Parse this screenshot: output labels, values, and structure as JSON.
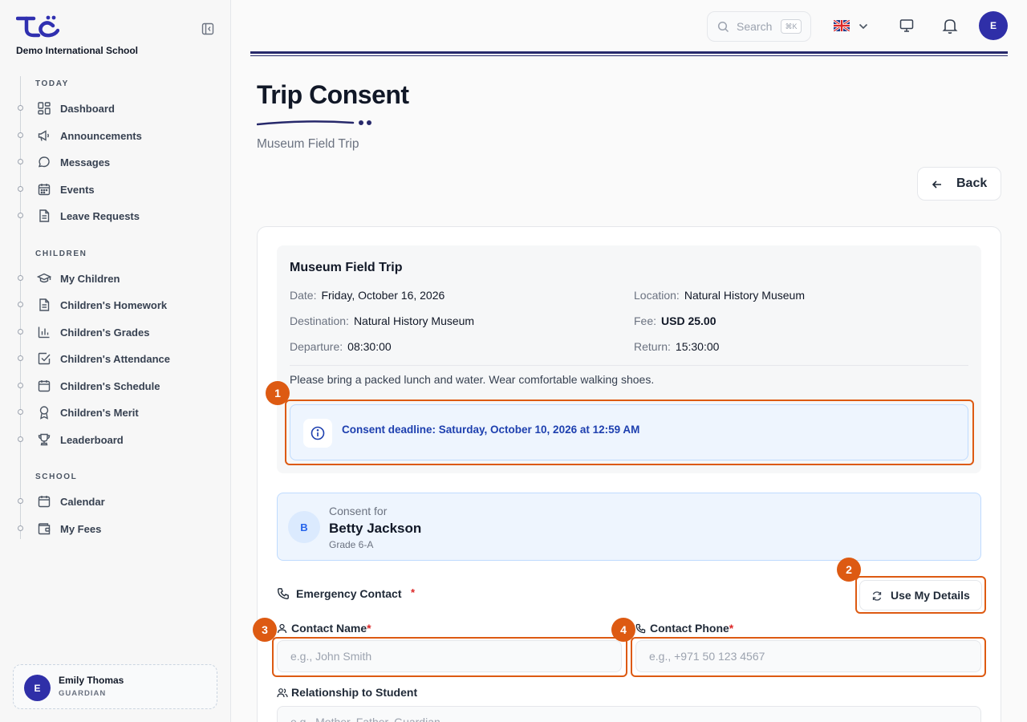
{
  "sidebar": {
    "school_name": "Demo International School",
    "sections": {
      "today": "TODAY",
      "children": "CHILDREN",
      "school": "SCHOOL"
    },
    "items": {
      "dashboard": "Dashboard",
      "announcements": "Announcements",
      "messages": "Messages",
      "events": "Events",
      "leave_requests": "Leave Requests",
      "my_children": "My Children",
      "homework": "Children's Homework",
      "grades": "Children's Grades",
      "attendance": "Children's Attendance",
      "schedule": "Children's Schedule",
      "merit": "Children's Merit",
      "leaderboard": "Leaderboard",
      "calendar": "Calendar",
      "my_fees": "My Fees"
    },
    "user": {
      "initial": "E",
      "name": "Emily Thomas",
      "role": "GUARDIAN"
    }
  },
  "topbar": {
    "search_placeholder": "Search",
    "search_shortcut": "⌘K",
    "avatar_initial": "E"
  },
  "page": {
    "title": "Trip Consent",
    "subtitle": "Museum Field Trip",
    "back_label": "Back"
  },
  "trip": {
    "title": "Museum Field Trip",
    "date_label": "Date:",
    "date": "Friday, October 16, 2026",
    "location_label": "Location:",
    "location": "Natural History Museum",
    "destination_label": "Destination:",
    "destination": "Natural History Museum",
    "fee_label": "Fee:",
    "fee": "USD 25.00",
    "departure_label": "Departure:",
    "departure": "08:30:00",
    "return_label": "Return:",
    "return": "15:30:00",
    "note": "Please bring a packed lunch and water. Wear comfortable walking shoes.",
    "deadline": "Consent deadline: Saturday, October 10, 2026 at 12:59 AM"
  },
  "consent": {
    "for_label": "Consent for",
    "initial": "B",
    "student_name": "Betty Jackson",
    "grade": "Grade 6-A"
  },
  "form": {
    "emergency_label": "Emergency Contact",
    "required_mark": "*",
    "use_my_details": "Use My Details",
    "contact_name_label": "Contact Name",
    "contact_name_placeholder": "e.g., John Smith",
    "contact_name_value": "",
    "contact_phone_label": "Contact Phone",
    "contact_phone_placeholder": "e.g., +971 50 123 4567",
    "contact_phone_value": "",
    "relationship_label": "Relationship to Student",
    "relationship_placeholder": "e.g., Mother, Father, Guardian",
    "relationship_value": ""
  },
  "annotations": [
    "1",
    "2",
    "3",
    "4"
  ],
  "colors": {
    "brand": "#2f2fa8",
    "highlight": "#dd5a12",
    "info_bg": "#eef5fe",
    "info_text": "#1e40af"
  }
}
